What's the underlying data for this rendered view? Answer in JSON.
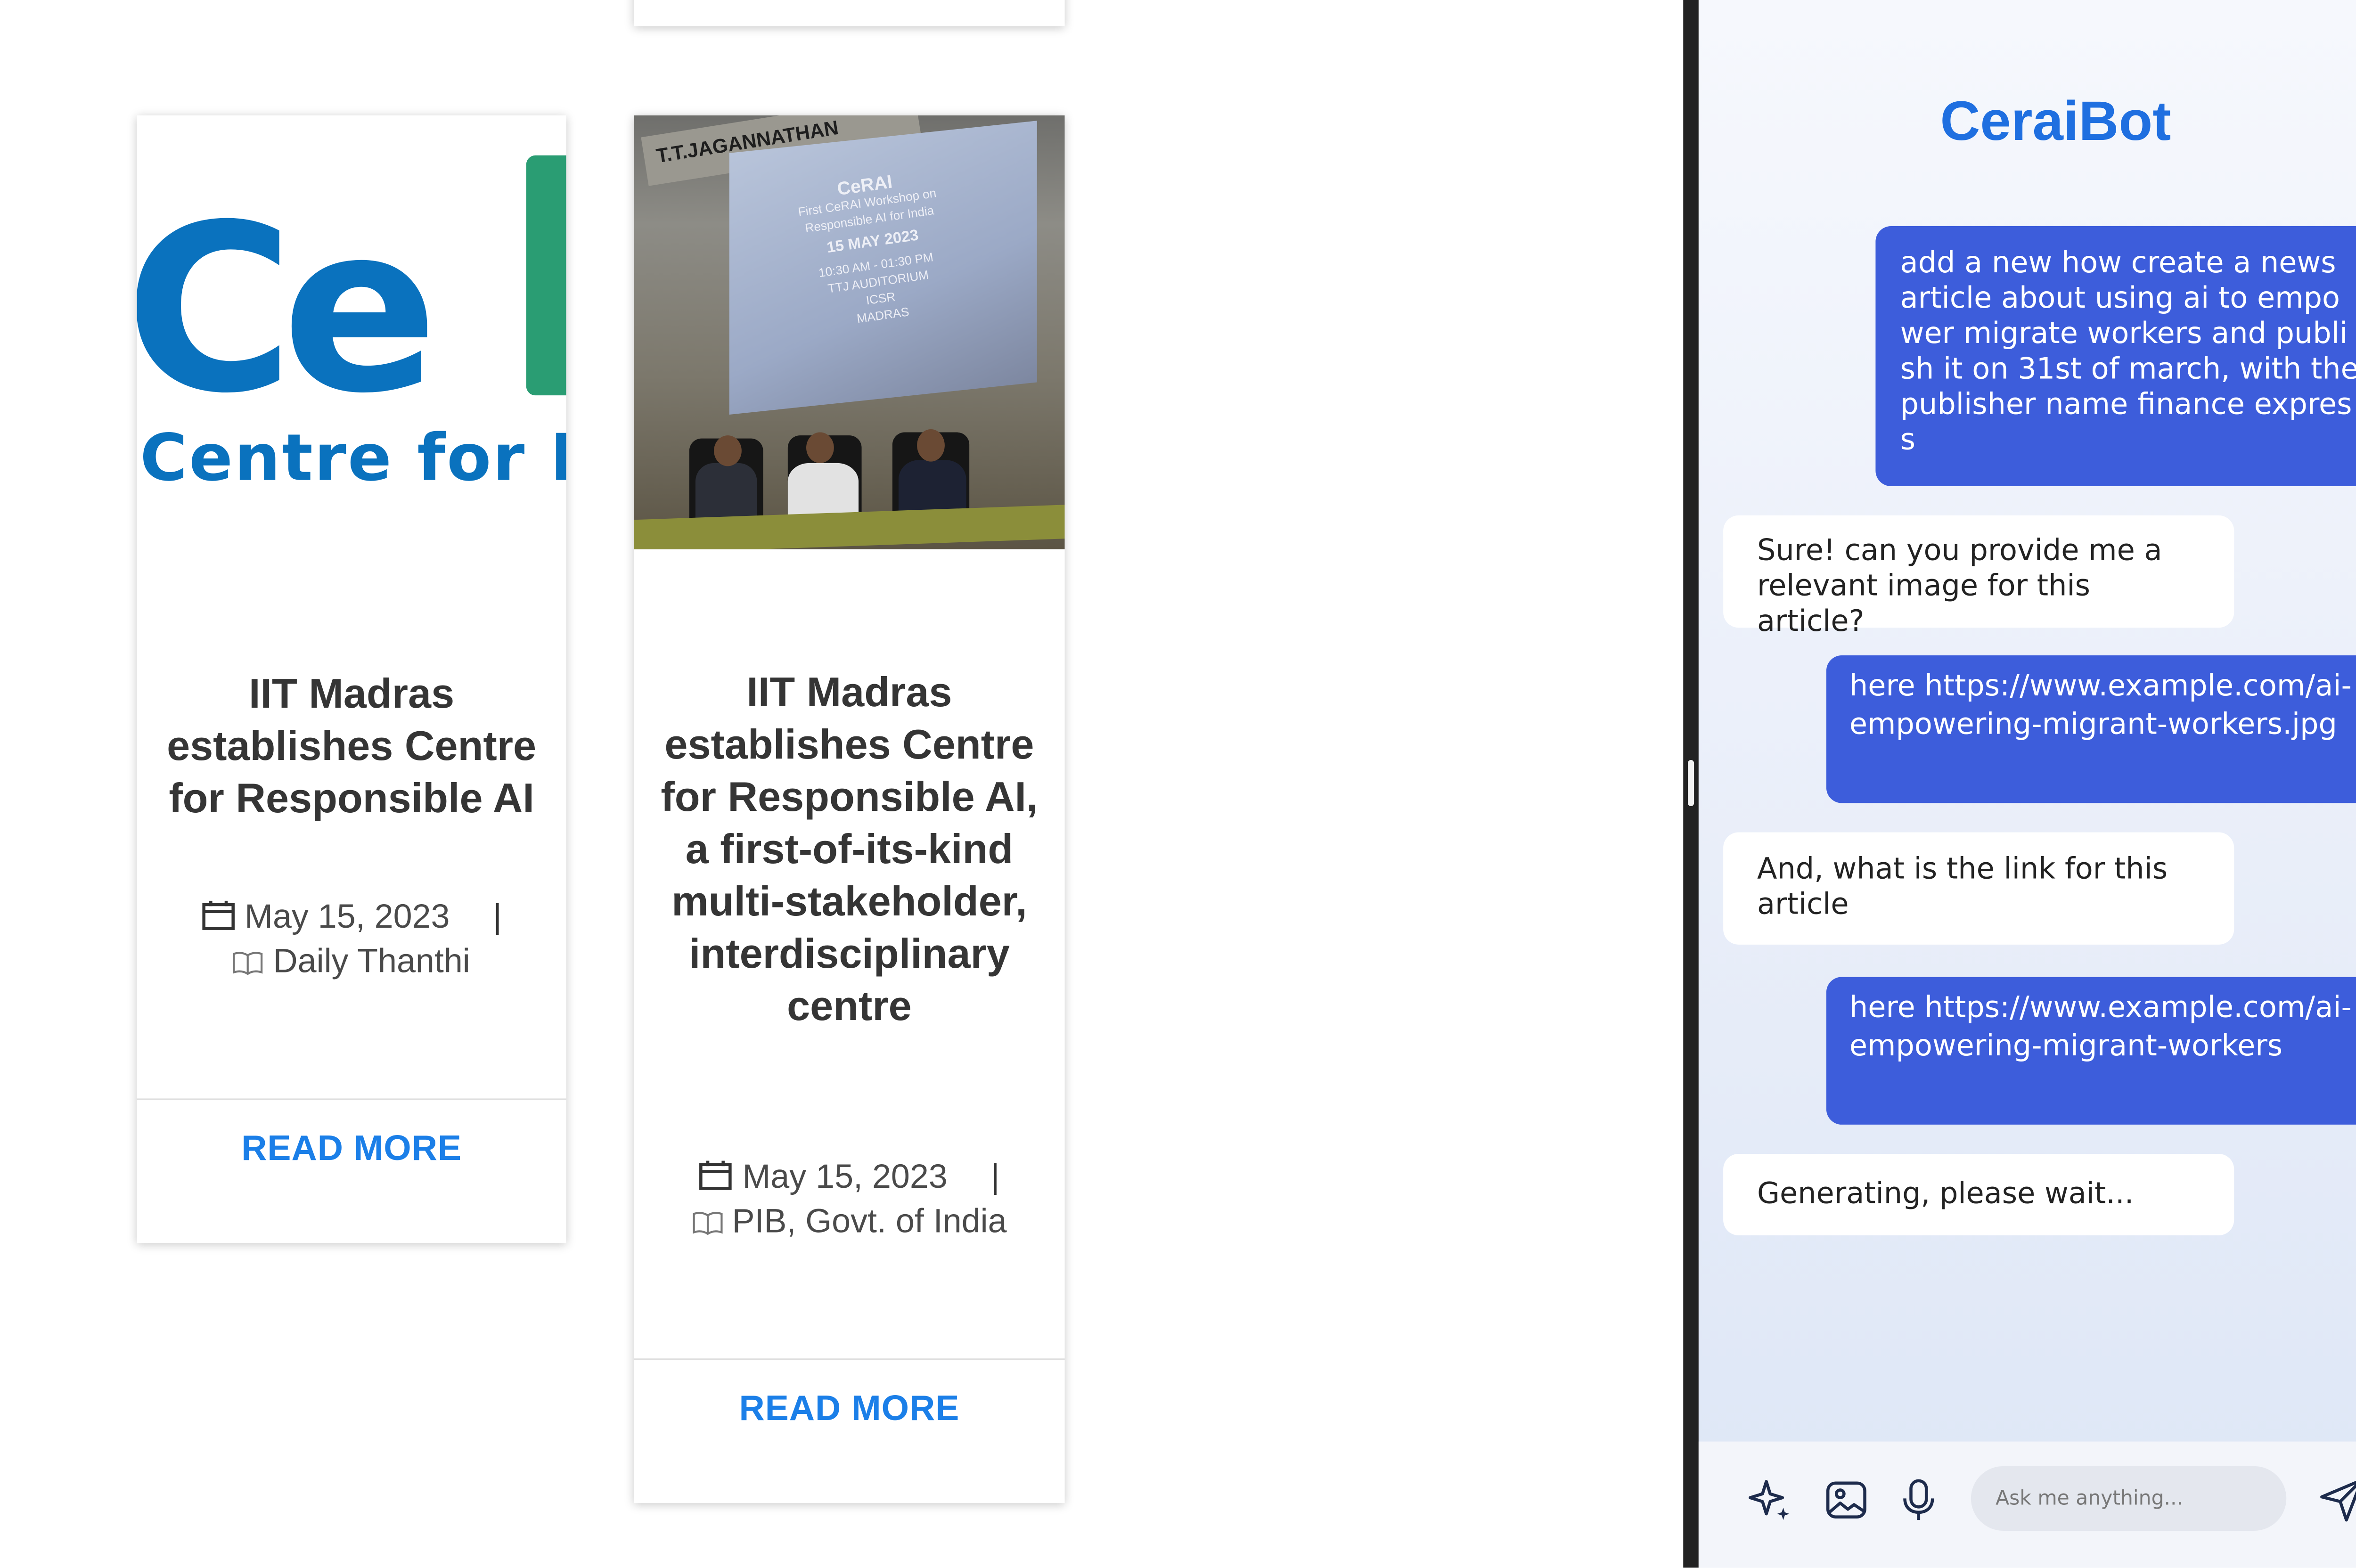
{
  "cards": [
    {
      "title": "IIT Madras establishes Centre for Responsible AI",
      "date": "May 15, 2023",
      "separator": "|",
      "publisher": "Daily Thanthi",
      "read_more": "READ MORE",
      "image": {
        "type": "logo",
        "logo_text": "Ce",
        "logo_subtext": "Centre for R",
        "colors": {
          "blue": "#0a72be",
          "green": "#2a9d73"
        }
      }
    },
    {
      "title": "IIT Madras establishes Centre for Responsible AI, a first-of-its-kind multi-stakeholder, interdisciplinary centre",
      "date": "May 15, 2023",
      "separator": "|",
      "publisher": "PIB, Govt. of India",
      "read_more": "READ MORE",
      "image": {
        "type": "photo",
        "banner_text": "T.T.JAGANNATHAN",
        "screen_lines": [
          "CeRAI",
          "First CeRAI Workshop on",
          "Responsible AI for India",
          "15 MAY 2023",
          "10:30 AM - 01:30 PM",
          "TTJ AUDITORIUM",
          "ICSR",
          "MADRAS"
        ]
      }
    }
  ],
  "chat": {
    "title": "CeraiBot",
    "messages": [
      {
        "role": "user",
        "text": "add a new how create a news article about using ai to empower migrate workers and publish it on 31st of march, with the publisher name finance express"
      },
      {
        "role": "bot",
        "text": "Sure! can you provide me a relevant image for this article?"
      },
      {
        "role": "user",
        "text": "here https://www.example.com/ai-empowering-migrant-workers.jpg"
      },
      {
        "role": "bot",
        "text": "And, what is the link for this article"
      },
      {
        "role": "user",
        "text": "here https://www.example.com/ai-empowering-migrant-workers"
      },
      {
        "role": "bot",
        "text": "Generating, please wait..."
      }
    ],
    "input": {
      "placeholder": "Ask me anything...",
      "value": ""
    },
    "icons": [
      "sparkle-icon",
      "image-icon",
      "microphone-icon",
      "send-icon"
    ]
  },
  "colors": {
    "accent": "#1f6fe0",
    "user_bubble": "#3d5ddb",
    "bot_bubble": "#ffffff",
    "read_more": "#1b7fe8",
    "splitter": "#222222"
  }
}
